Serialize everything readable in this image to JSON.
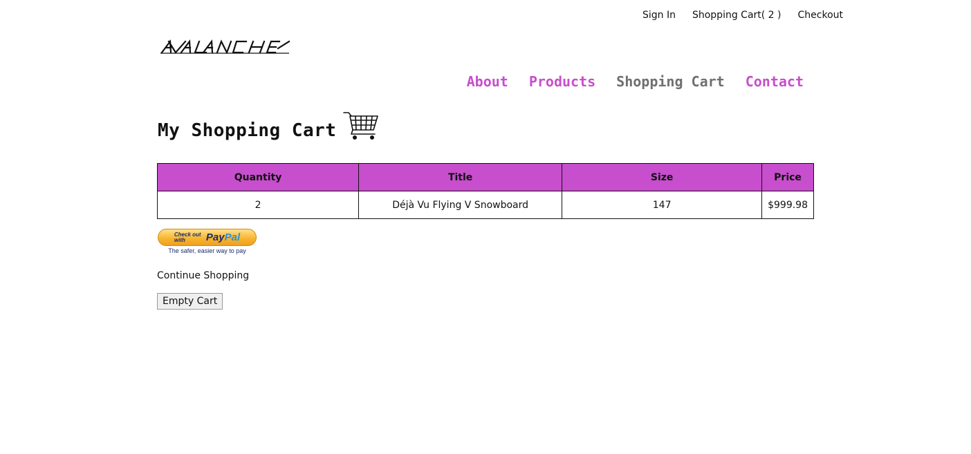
{
  "colors": {
    "accent": "#c74ecc",
    "nav_active": "#6f6f6f",
    "text": "#111111"
  },
  "top_links": {
    "sign_in": "Sign In",
    "cart": "Shopping Cart( 2 )",
    "checkout": "Checkout"
  },
  "logo": {
    "text": "AVALANCHE"
  },
  "nav": {
    "about": "About",
    "products": "Products",
    "shopping_cart": "Shopping Cart",
    "contact": "Contact"
  },
  "page": {
    "title": "My Shopping Cart",
    "icon": "shopping-cart-icon"
  },
  "cart_table": {
    "headers": [
      "Quantity",
      "Title",
      "Size",
      "Price"
    ],
    "rows": [
      [
        "2",
        "Déjà Vu Flying V Snowboard",
        "147",
        "$999.98"
      ]
    ]
  },
  "paypal": {
    "small_text": "Check out\nwith",
    "brand_pay": "Pay",
    "brand_pal": "Pal",
    "tagline": "The safer, easier way to pay"
  },
  "continue_label": "Continue Shopping",
  "empty_cart_label": "Empty Cart"
}
